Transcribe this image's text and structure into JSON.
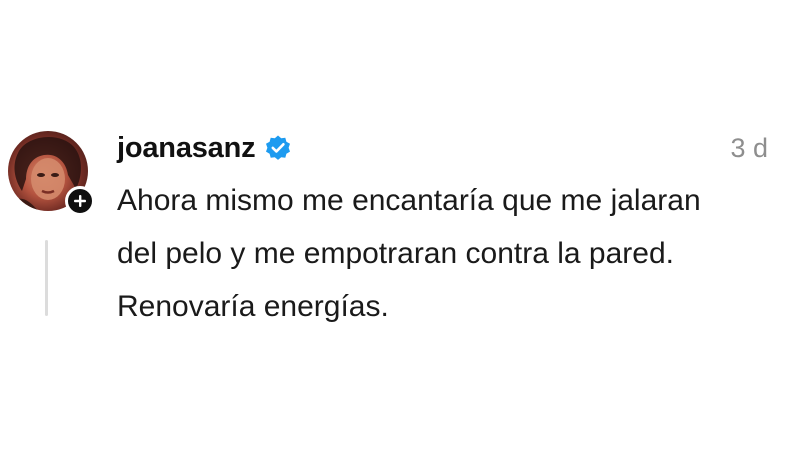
{
  "comment": {
    "username": "joanasanz",
    "verified": true,
    "timestamp": "3 d",
    "lines": [
      "Ahora mismo me encantaría que me jalaran",
      "del pelo y me empotraran contra la pared.",
      "Renovaría energías."
    ],
    "avatar_icon": "profile-photo",
    "badge_icon": "plus-icon",
    "verified_icon": "verified-badge-icon"
  },
  "colors": {
    "verified_blue": "#1d9bf0",
    "text": "#1a1a1a",
    "timestamp": "#8e8e8e",
    "thread_line": "#dcdcdc"
  }
}
